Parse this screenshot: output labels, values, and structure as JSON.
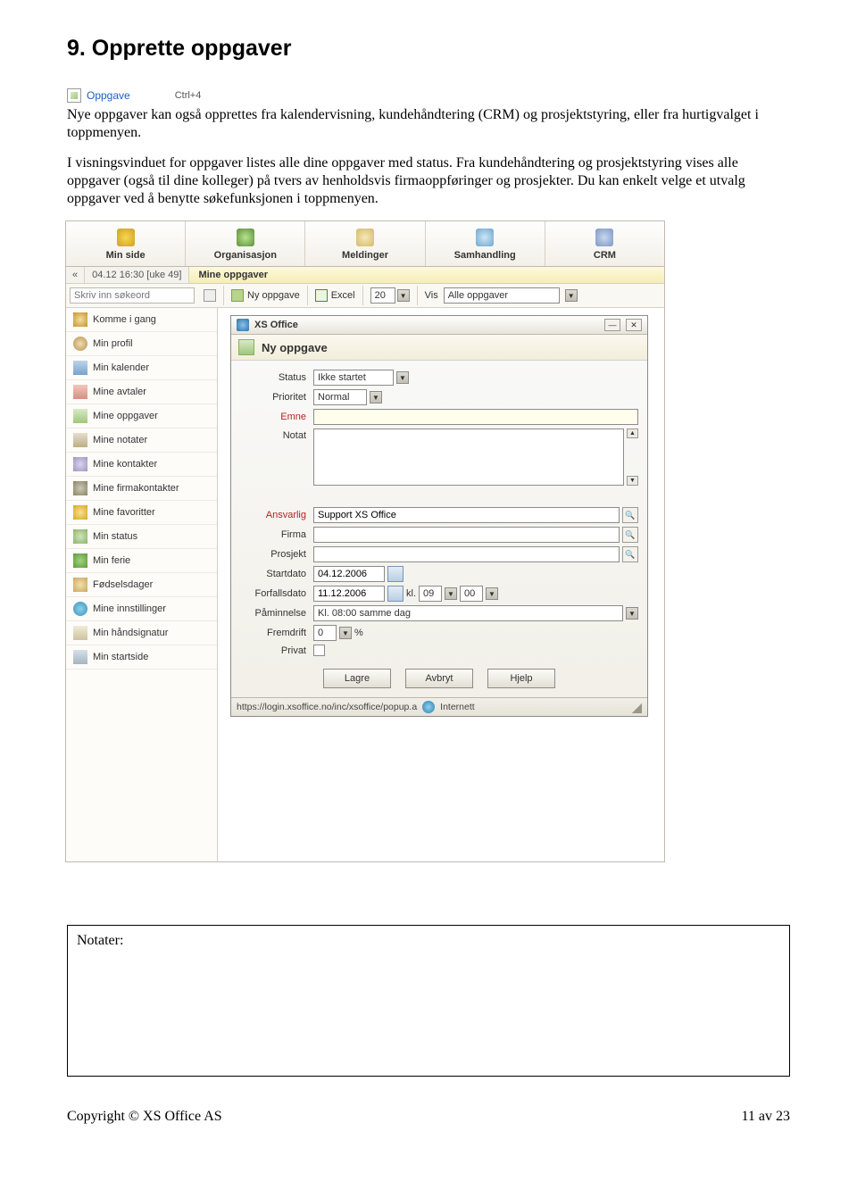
{
  "title": "9. Opprette oppgaver",
  "shortcut": {
    "label": "Oppgave",
    "key": "Ctrl+4"
  },
  "paragraph1_a": " Nye oppgaver kan også opprettes fra kalendervisning, kundehåndtering (CRM) og prosjektstyring, eller fra hurtigvalget i toppmenyen.",
  "paragraph2": "I visningsvinduet for oppgaver listes alle dine oppgaver med status. Fra kundehåndtering og prosjektstyring vises alle oppgaver (også til dine kolleger) på tvers av henholdsvis firmaoppføringer og prosjekter. Du kan enkelt velge et utvalg oppgaver ved å benytte søkefunksjonen i toppmenyen.",
  "tabs": {
    "t1": "Min side",
    "t2": "Organisasjon",
    "t3": "Meldinger",
    "t4": "Samhandling",
    "t5": "CRM"
  },
  "datebar": {
    "chev": "«",
    "text": "04.12 16:30 [uke 49]",
    "heading": "Mine oppgaver"
  },
  "toolbar": {
    "search_placeholder": "Skriv inn søkeord",
    "new_task": "Ny oppgave",
    "excel": "Excel",
    "page_size": "20",
    "vis": "Vis",
    "filter": "Alle oppgaver"
  },
  "sidebar": [
    "Komme i gang",
    "Min profil",
    "Min kalender",
    "Mine avtaler",
    "Mine oppgaver",
    "Mine notater",
    "Mine kontakter",
    "Mine firmakontakter",
    "Mine favoritter",
    "Min status",
    "Min ferie",
    "Fødselsdager",
    "Mine innstillinger",
    "Min håndsignatur",
    "Min startside"
  ],
  "popup": {
    "window_title": "XS Office",
    "heading": "Ny oppgave",
    "labels": {
      "status": "Status",
      "prioritet": "Prioritet",
      "emne": "Emne",
      "notat": "Notat",
      "ansvarlig": "Ansvarlig",
      "firma": "Firma",
      "prosjekt": "Prosjekt",
      "startdato": "Startdato",
      "forfallsdato": "Forfallsdato",
      "paminnelse": "Påminnelse",
      "fremdrift": "Fremdrift",
      "privat": "Privat",
      "kl": "kl.",
      "pct": "%"
    },
    "values": {
      "status": "Ikke startet",
      "prioritet": "Normal",
      "emne": "",
      "notat": "",
      "ansvarlig": "Support XS Office",
      "firma": "",
      "prosjekt": "",
      "startdato": "04.12.2006",
      "forfallsdato": "11.12.2006",
      "kl_h": "09",
      "kl_m": "00",
      "paminnelse": "Kl. 08:00 samme dag",
      "fremdrift": "0"
    },
    "buttons": {
      "lagre": "Lagre",
      "avbryt": "Avbryt",
      "hjelp": "Hjelp"
    },
    "status_url": "https://login.xsoffice.no/inc/xsoffice/popup.a",
    "status_zone": "Internett"
  },
  "notes_label": "Notater:",
  "footer": {
    "left": "Copyright © XS Office AS",
    "right": "11 av 23"
  }
}
